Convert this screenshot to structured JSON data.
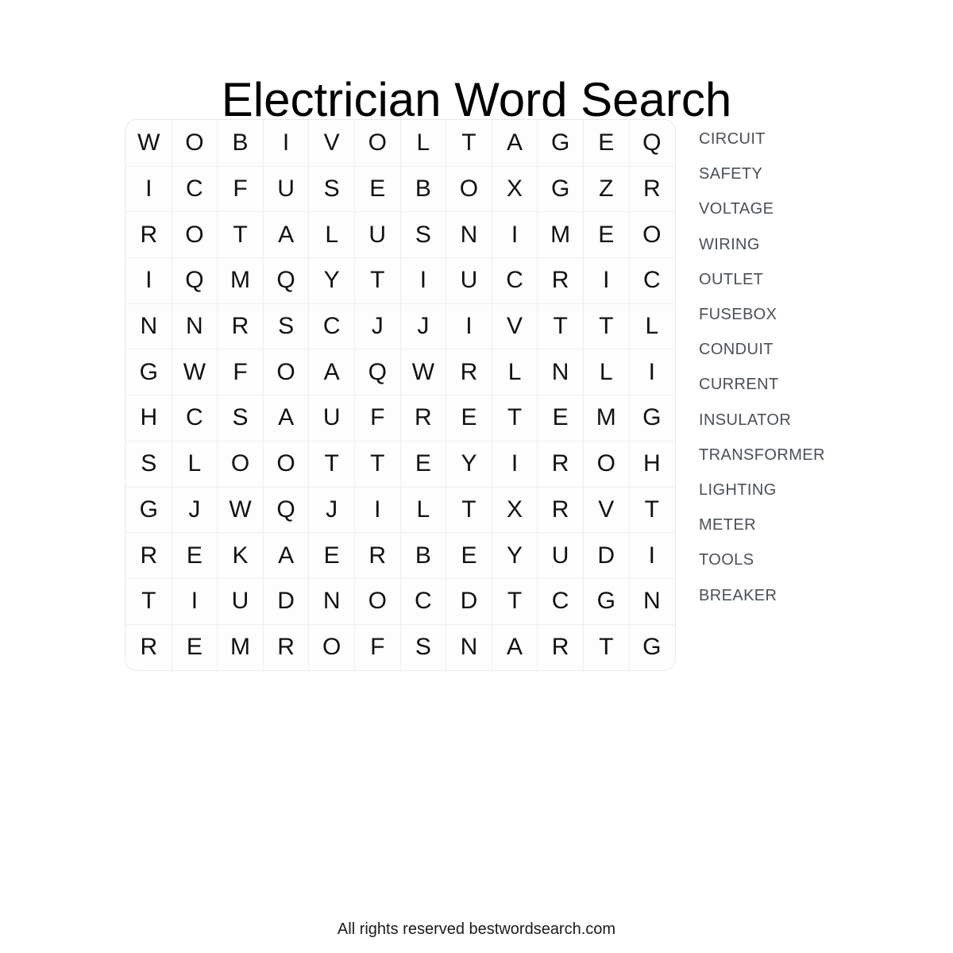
{
  "title": "Electrician Word Search",
  "footer": "All rights reserved bestwordsearch.com",
  "grid": {
    "rows": 12,
    "cols": 12,
    "letters": [
      [
        "W",
        "O",
        "B",
        "I",
        "V",
        "O",
        "L",
        "T",
        "A",
        "G",
        "E",
        "Q"
      ],
      [
        "I",
        "C",
        "F",
        "U",
        "S",
        "E",
        "B",
        "O",
        "X",
        "G",
        "Z",
        "R"
      ],
      [
        "R",
        "O",
        "T",
        "A",
        "L",
        "U",
        "S",
        "N",
        "I",
        "M",
        "E",
        "O"
      ],
      [
        "I",
        "Q",
        "M",
        "Q",
        "Y",
        "T",
        "I",
        "U",
        "C",
        "R",
        "I",
        "C"
      ],
      [
        "N",
        "N",
        "R",
        "S",
        "C",
        "J",
        "J",
        "I",
        "V",
        "T",
        "T",
        "L"
      ],
      [
        "G",
        "W",
        "F",
        "O",
        "A",
        "Q",
        "W",
        "R",
        "L",
        "N",
        "L",
        "I"
      ],
      [
        "H",
        "C",
        "S",
        "A",
        "U",
        "F",
        "R",
        "E",
        "T",
        "E",
        "M",
        "G"
      ],
      [
        "S",
        "L",
        "O",
        "O",
        "T",
        "T",
        "E",
        "Y",
        "I",
        "R",
        "O",
        "H"
      ],
      [
        "G",
        "J",
        "W",
        "Q",
        "J",
        "I",
        "L",
        "T",
        "X",
        "R",
        "V",
        "T"
      ],
      [
        "R",
        "E",
        "K",
        "A",
        "E",
        "R",
        "B",
        "E",
        "Y",
        "U",
        "D",
        "I"
      ],
      [
        "T",
        "I",
        "U",
        "D",
        "N",
        "O",
        "C",
        "D",
        "T",
        "C",
        "G",
        "N"
      ],
      [
        "R",
        "E",
        "M",
        "R",
        "O",
        "F",
        "S",
        "N",
        "A",
        "R",
        "T",
        "G"
      ]
    ]
  },
  "word_list": {
    "words": [
      "CIRCUIT",
      "SAFETY",
      "VOLTAGE",
      "WIRING",
      "OUTLET",
      "FUSEBOX",
      "CONDUIT",
      "CURRENT",
      "INSULATOR",
      "TRANSFORMER",
      "LIGHTING",
      "METER",
      "TOOLS",
      "BREAKER"
    ]
  },
  "colors": {
    "page_background": "#ffffff",
    "grid_background": "#fdfdfd",
    "grid_line": "#eceef3",
    "letter_text": "#111111",
    "word_list_text": "#4a4f58",
    "title_text": "#000000"
  }
}
